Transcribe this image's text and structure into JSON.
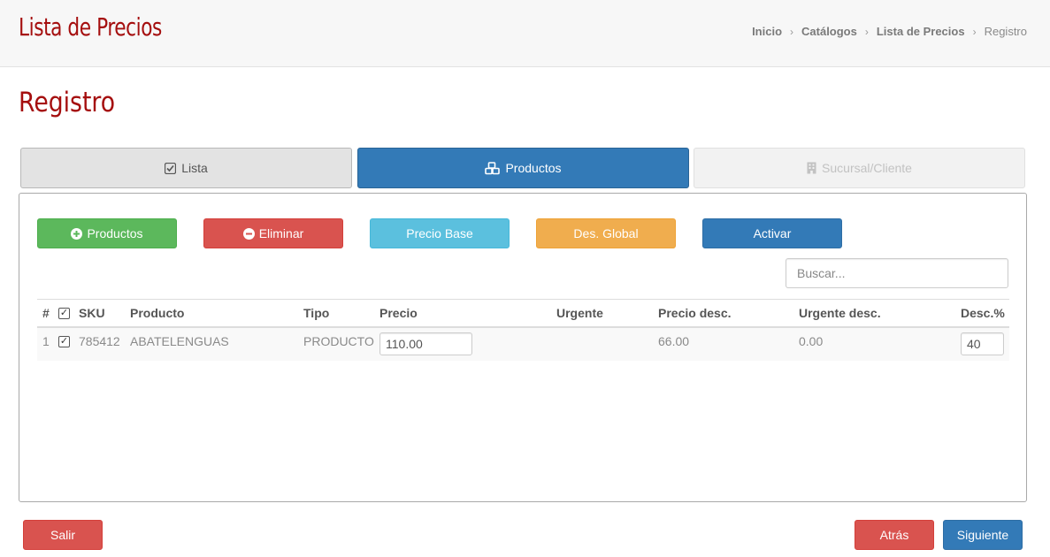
{
  "header": {
    "app_title": "Lista de Precios",
    "breadcrumb": [
      "Inicio",
      "Catálogos",
      "Lista de Precios",
      "Registro"
    ]
  },
  "page_title": "Registro",
  "steps": [
    {
      "label": "Lista",
      "icon": "check-square-icon",
      "state": "done"
    },
    {
      "label": "Productos",
      "icon": "cubes-icon",
      "state": "active"
    },
    {
      "label": "Sucursal/Cliente",
      "icon": "building-icon",
      "state": "disabled"
    }
  ],
  "toolbar": {
    "add_products": "Productos",
    "delete": "Eliminar",
    "base_price": "Precio Base",
    "global_discount": "Des. Global",
    "activate": "Activar"
  },
  "search": {
    "placeholder": "Buscar...",
    "value": ""
  },
  "table": {
    "headers": {
      "num": "#",
      "sku": "SKU",
      "product": "Producto",
      "type": "Tipo",
      "price": "Precio",
      "urgent": "Urgente",
      "price_disc": "Precio desc.",
      "urgent_disc": "Urgente desc.",
      "disc_pct": "Desc.%"
    },
    "rows": [
      {
        "num": "1",
        "checked": true,
        "sku": "785412",
        "product": "ABATELENGUAS",
        "type": "PRODUCTO",
        "price": "110.00",
        "urgent": "",
        "price_disc": "66.00",
        "urgent_disc": "0.00",
        "disc_pct": "40"
      }
    ]
  },
  "footer": {
    "exit": "Salir",
    "back": "Atrás",
    "next": "Siguiente"
  },
  "colors": {
    "title_red": "#a50f0f",
    "primary": "#337ab7",
    "success": "#5cb85c",
    "danger": "#d9534f",
    "info": "#5bc0de",
    "warning": "#f0ad4e"
  }
}
